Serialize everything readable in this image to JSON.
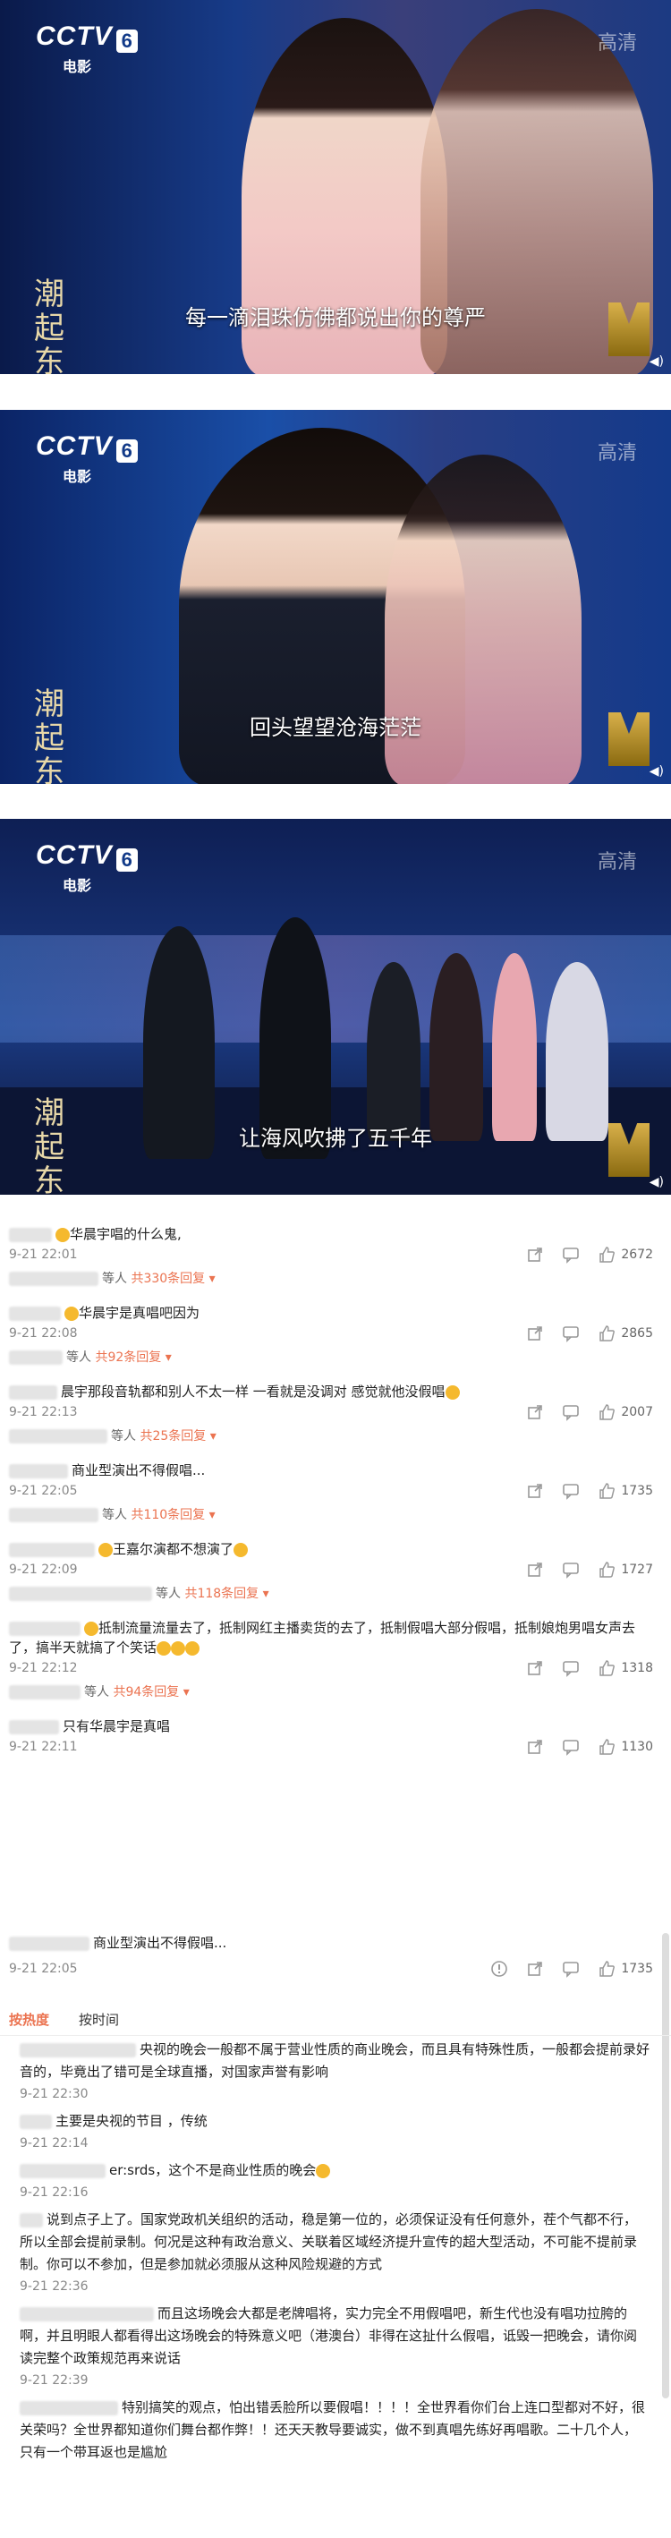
{
  "videos": [
    {
      "channel": "CCTV",
      "channel_num": "6",
      "channel_sub": "电影",
      "hd": "高清",
      "subtitle": "每一滴泪珠仿佛都说出你的尊严"
    },
    {
      "channel": "CCTV",
      "channel_num": "6",
      "channel_sub": "电影",
      "hd": "高清",
      "subtitle": "回头望望沧海茫茫"
    },
    {
      "channel": "CCTV",
      "channel_num": "6",
      "channel_sub": "电影",
      "hd": "高清",
      "subtitle": "让海风吹拂了五千年"
    }
  ],
  "comments": [
    {
      "text": "华晨宇唱的什么鬼,",
      "time": "9-21 22:01",
      "likes": "2672",
      "reply_suffix": "等人",
      "reply_count": "共330条回复"
    },
    {
      "text": "华晨宇是真唱吧因为",
      "time": "9-21 22:08",
      "likes": "2865",
      "reply_suffix": "等人",
      "reply_count": "共92条回复"
    },
    {
      "text": "晨宇那段音轨都和别人不太一样 一看就是没调对 感觉就他没假唱",
      "time": "9-21 22:13",
      "likes": "2007",
      "reply_suffix": "等人",
      "reply_count": "共25条回复"
    },
    {
      "text": "商业型演出不得假唱...",
      "time": "9-21 22:05",
      "likes": "1735",
      "reply_suffix": "等人",
      "reply_count": "共110条回复"
    },
    {
      "text": "王嘉尔演都不想演了",
      "time": "9-21 22:09",
      "likes": "1727",
      "reply_suffix": "等人",
      "reply_count": "共118条回复"
    },
    {
      "text": "抵制流量流量去了，抵制网红主播卖货的去了，抵制假唱大部分假唱，抵制娘炮男唱女声去了，搞半天就搞了个笑话",
      "time": "9-21 22:12",
      "likes": "1318",
      "reply_suffix": "等人",
      "reply_count": "共94条回复"
    },
    {
      "text": "只有华晨宇是真唱",
      "time": "9-21 22:11",
      "likes": "1130"
    }
  ],
  "pinned": {
    "text": "商业型演出不得假唱...",
    "time": "9-21 22:05",
    "likes": "1735"
  },
  "tabs": {
    "hot": "按热度",
    "time": "按时间"
  },
  "sub_comments": [
    {
      "text": "央视的晚会一般都不属于营业性质的商业晚会，而且具有特殊性质，一般都会提前录好音的，毕竟出了错可是全球直播，对国家声誉有影响",
      "time": "9-21 22:30"
    },
    {
      "text": "主要是央视的节目 ，传统",
      "time": "9-21 22:14"
    },
    {
      "text": "er:srds，这个不是商业性质的晚会",
      "time": "9-21 22:16"
    },
    {
      "text": "说到点子上了。国家党政机关组织的活动，稳是第一位的，必须保证没有任何意外，茬个气都不行，所以全部会提前录制。何况是这种有政治意义、关联着区域经济提升宣传的超大型活动，不可能不提前录制。你可以不参加，但是参加就必须服从这种风险规避的方式",
      "time": "9-21 22:36"
    },
    {
      "text": "而且这场晚会大都是老牌唱将，实力完全不用假唱吧，新生代也没有唱功拉胯的啊，并且明眼人都看得出这场晚会的特殊意义吧（港澳台）非得在这扯什么假唱，诋毁一把晚会，请你阅读完整个政策规范再来说话",
      "time": "9-21 22:39"
    },
    {
      "text": "特别搞笑的观点，怕出错丢脸所以要假唱！！！！全世界看你们台上连口型都对不好，很关荣吗？全世界都知道你们舞台都作弊！！还天天教导要诚实，做不到真唱先练好再唱歌。二十几个人，只有一个带耳返也是尴尬",
      "time": ""
    }
  ]
}
